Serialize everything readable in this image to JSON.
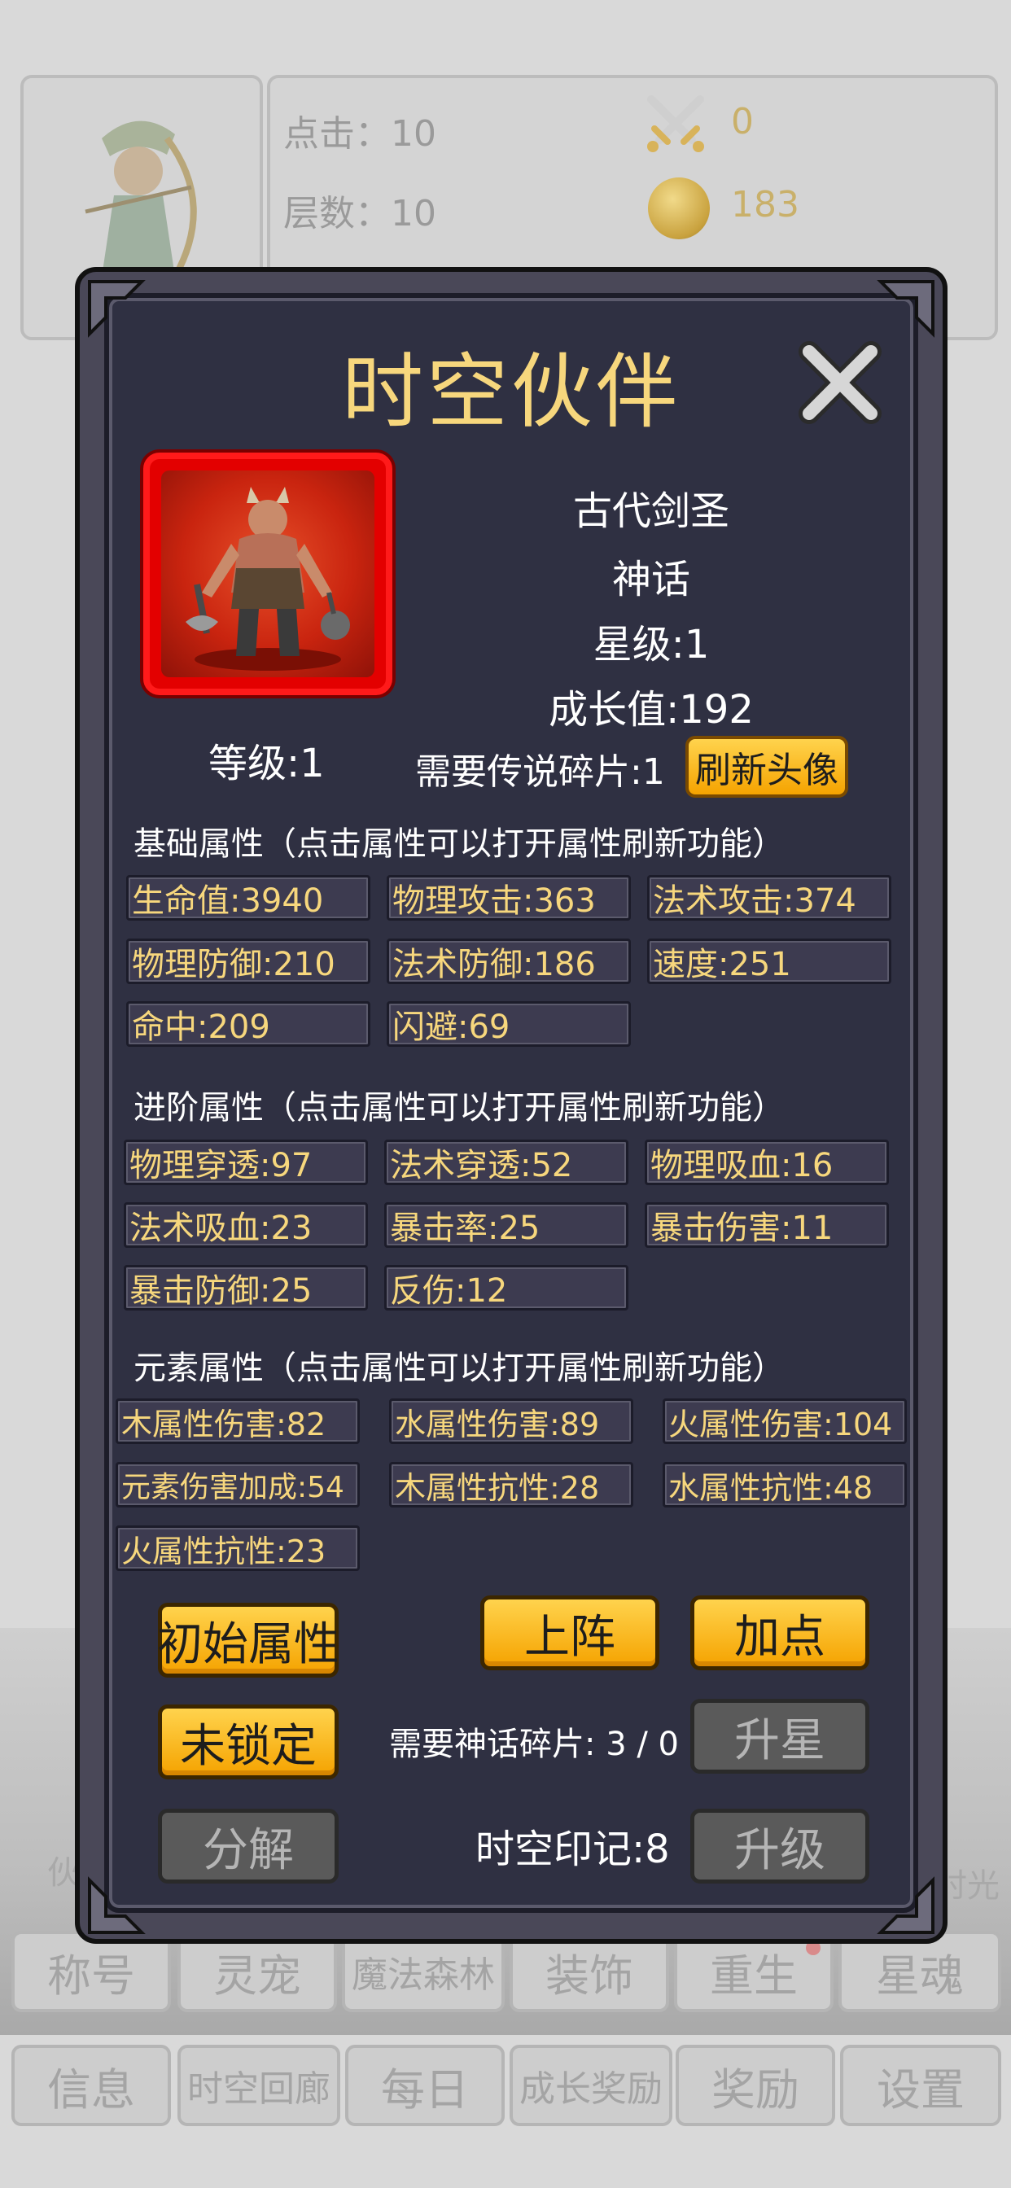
{
  "background": {
    "click_label": "点击：10",
    "floor_label": "层数：10",
    "sword_count": "0",
    "coin_count": "183",
    "side_left_label": "伙",
    "side_right_label": "时光",
    "nav_row1": [
      "称号",
      "灵宠",
      "魔法森林",
      "装饰",
      "重生",
      "星魂"
    ],
    "nav_row2": [
      "信息",
      "时空回廊",
      "每日",
      "成长奖励",
      "奖励",
      "设置"
    ]
  },
  "modal": {
    "title": "时空伙伴",
    "partner": {
      "name": "古代剑圣",
      "rarity": "神话",
      "star": "星级:1",
      "growth": "成长值:192",
      "level": "等级:1",
      "legend_shards": "需要传说碎片:1",
      "refresh_button": "刷新头像"
    },
    "basic": {
      "title": "基础属性（点击属性可以打开属性刷新功能）",
      "items": [
        "生命值:3940",
        "物理攻击:363",
        "法术攻击:374",
        "物理防御:210",
        "法术防御:186",
        "速度:251",
        "命中:209",
        "闪避:69"
      ]
    },
    "advanced": {
      "title": "进阶属性（点击属性可以打开属性刷新功能）",
      "items": [
        "物理穿透:97",
        "法术穿透:52",
        "物理吸血:16",
        "法术吸血:23",
        "暴击率:25",
        "暴击伤害:11",
        "暴击防御:25",
        "反伤:12"
      ]
    },
    "element": {
      "title": "元素属性（点击属性可以打开属性刷新功能）",
      "items": [
        "木属性伤害:82",
        "水属性伤害:89",
        "火属性伤害:104",
        "元素伤害加成:54",
        "木属性抗性:28",
        "水属性抗性:48",
        "火属性抗性:23"
      ]
    },
    "buttons": {
      "initial_attr": "初始属性",
      "deploy": "上阵",
      "add_points": "加点",
      "unlocked": "未锁定",
      "star_up": "升星",
      "decompose": "分解",
      "level_up": "升级"
    },
    "myth_shards": "需要神话碎片: 3 / 0",
    "spacetime_mark": "时空印记:8"
  },
  "colors": {
    "gold_text": "#f7d77d",
    "panel_bg": "#2f3042",
    "button_gold": "#f5a300",
    "portrait_red": "#e30000"
  },
  "icons": [
    "close-icon",
    "crossed-swords-icon",
    "gold-coin-icon"
  ]
}
